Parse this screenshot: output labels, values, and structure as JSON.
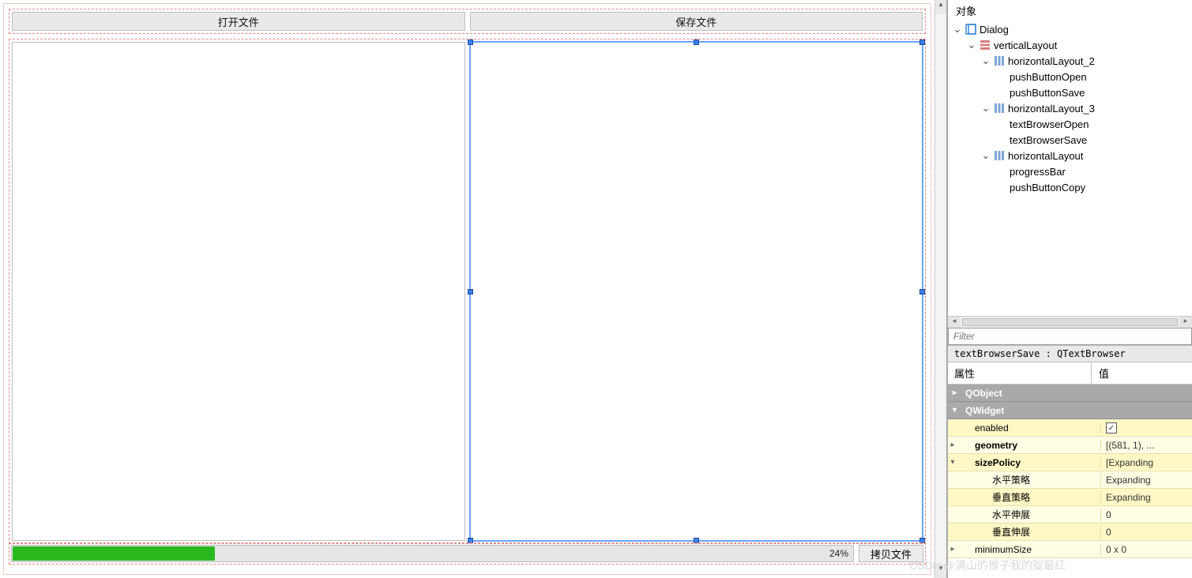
{
  "form": {
    "open_button": "打开文件",
    "save_button": "保存文件",
    "copy_button": "拷贝文件",
    "progress_percent": "24%",
    "progress_value": 24
  },
  "object_tree": {
    "header": "对象",
    "items": [
      "Dialog",
      "verticalLayout",
      "horizontalLayout_2",
      "pushButtonOpen",
      "pushButtonSave",
      "horizontalLayout_3",
      "textBrowserOpen",
      "textBrowserSave",
      "horizontalLayout",
      "progressBar",
      "pushButtonCopy"
    ]
  },
  "filter_placeholder": "Filter",
  "selected_object": "textBrowserSave : QTextBrowser",
  "prop_header_attr": "属性",
  "prop_header_val": "值",
  "groups": {
    "qobject": "QObject",
    "qwidget": "QWidget"
  },
  "props": {
    "enabled": {
      "k": "enabled",
      "checked": true
    },
    "geometry": {
      "k": "geometry",
      "v": "[(581, 1), ..."
    },
    "sizePolicy": {
      "k": "sizePolicy",
      "v": "[Expanding"
    },
    "hp": {
      "k": "水平策略",
      "v": "Expanding"
    },
    "vp": {
      "k": "垂直策略",
      "v": "Expanding"
    },
    "hs": {
      "k": "水平伸展",
      "v": "0"
    },
    "vs": {
      "k": "垂直伸展",
      "v": "0"
    },
    "minSize": {
      "k": "minimumSize",
      "v": "0 x 0"
    }
  },
  "watermark": "CSDN @满山的猴子我的腚最红"
}
